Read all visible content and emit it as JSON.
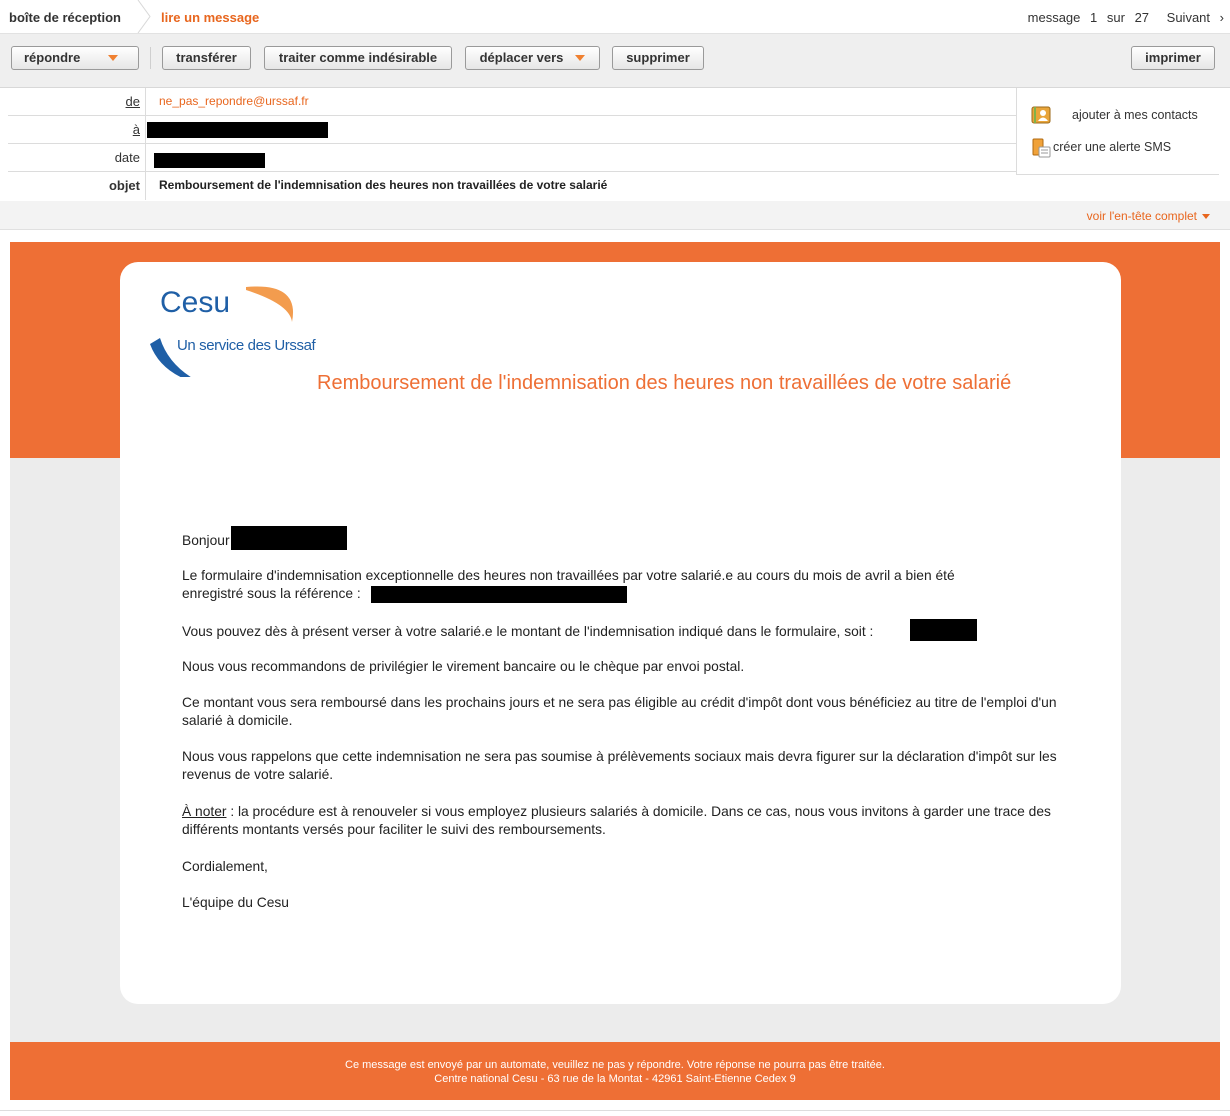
{
  "nav": {
    "breadcrumb_inbox": "boîte de réception",
    "breadcrumb_current": "lire un message",
    "message_word": "message",
    "message_index": "1",
    "of_word": "sur",
    "message_total": "27",
    "next_label": "Suivant"
  },
  "toolbar": {
    "reply": "répondre",
    "forward": "transférer",
    "spam": "traiter comme indésirable",
    "move": "déplacer vers",
    "delete": "supprimer",
    "print": "imprimer"
  },
  "header": {
    "from_label": "de",
    "from_value": "ne_pas_repondre@urssaf.fr",
    "to_label": "à",
    "date_label": "date",
    "subject_label": "objet",
    "subject_value": "Remboursement de l'indemnisation des heures non travaillées de votre salarié",
    "add_contact": "ajouter à mes contacts",
    "sms_alert": "créer une alerte SMS",
    "full_header_link": "voir l'en-tête complet"
  },
  "email": {
    "logo_name": "Cesu",
    "logo_tagline": "Un service des Urssaf",
    "title": "Remboursement de l'indemnisation des heures non travaillées de votre salarié",
    "greeting": "Bonjour",
    "p1_line1": "Le formulaire d'indemnisation exceptionnelle des heures non travaillées par votre salarié.e au cours du mois de avril a bien été",
    "p1_line2": "enregistré sous la référence :",
    "p2": "Vous pouvez dès à présent verser à votre salarié.e le montant de l'indemnisation indiqué dans le formulaire, soit :",
    "p3": "Nous vous recommandons de privilégier le virement bancaire ou le chèque par envoi postal.",
    "p4": "Ce montant vous sera remboursé dans les prochains jours et ne sera pas éligible au crédit d'impôt dont vous bénéficiez au titre de l'emploi d'un salarié à domicile.",
    "p5": "Nous vous rappelons que cette indemnisation ne sera pas soumise à prélèvements sociaux mais devra figurer sur la déclaration d'impôt sur les revenus de votre salarié.",
    "note_label": "À noter",
    "note_text": " : la procédure est à renouveler si vous employez plusieurs salariés à domicile. Dans ce cas, nous vous invitons à garder une trace des différents montants versés pour faciliter le suivi des remboursements.",
    "closing": "Cordialement,",
    "signature": "L'équipe du Cesu",
    "footer_line1": "Ce message est envoyé par un automate, veuillez ne pas y répondre. Votre réponse ne pourra pas être traitée.",
    "footer_line2": "Centre national Cesu - 63 rue de la Montat - 42961 Saint-Etienne Cedex 9"
  },
  "colors": {
    "accent": "#ee6f35",
    "link": "#e8661e",
    "logo_blue": "#1f5fa6"
  }
}
